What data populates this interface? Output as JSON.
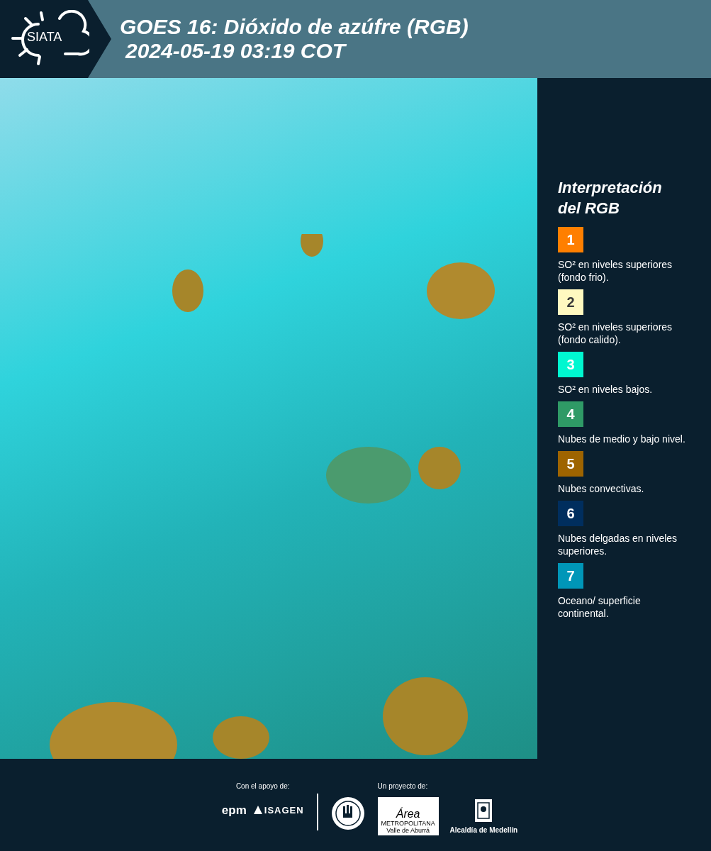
{
  "header": {
    "logo_text": "SIATA",
    "title": "GOES 16: Dióxido de azúfre (RGB)",
    "timestamp": "2024-05-19 03:19 COT"
  },
  "legend": {
    "title": "Interpretación del RGB",
    "items": [
      {
        "number": "1",
        "color": "#ff7f00",
        "label": "SO² en niveles superiores (fondo frio)."
      },
      {
        "number": "2",
        "color": "#fff9c0",
        "label": "SO² en niveles superiores (fondo calido)."
      },
      {
        "number": "3",
        "color": "#00f7d0",
        "label": "SO² en niveles bajos."
      },
      {
        "number": "4",
        "color": "#2f9a66",
        "label": "Nubes de medio y bajo nivel."
      },
      {
        "number": "5",
        "color": "#9e6400",
        "label": "Nubes convectivas."
      },
      {
        "number": "6",
        "color": "#002e5e",
        "label": "Nubes delgadas en niveles superiores."
      },
      {
        "number": "7",
        "color": "#0096b8",
        "label": "Oceano/ superficie continental."
      }
    ]
  },
  "footer": {
    "support_label": "Con el apoyo de:",
    "project_label": "Un proyecto de:",
    "support_logos": [
      "epm",
      "ISAGEN"
    ],
    "area_logo": {
      "script": "Área",
      "line_1": "METROPOLITANA",
      "line_2": "Valle de Aburrá"
    },
    "alcaldia_label": "Alcaldía de Medellín"
  }
}
